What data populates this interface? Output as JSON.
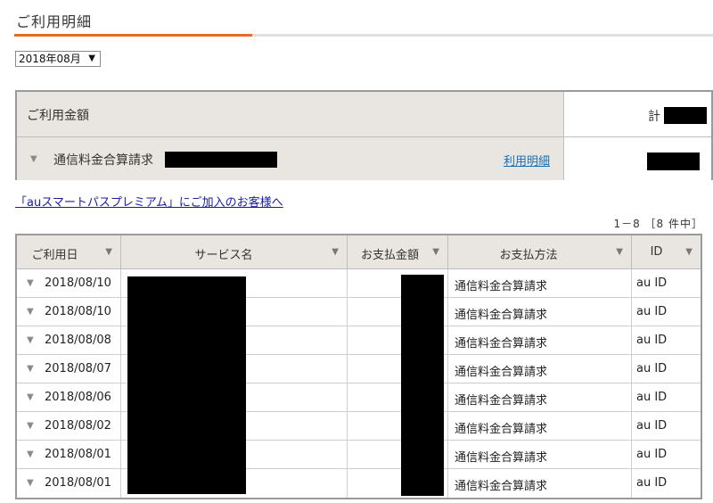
{
  "page": {
    "title": "ご利用明細"
  },
  "colors": {
    "accent": "#e8692e",
    "header_bg": "#e9e6e1",
    "link": "#1a6fb4",
    "redaction": "#000000"
  },
  "month_select": {
    "value": "2018年08月"
  },
  "summary": {
    "total_label": "ご利用金額",
    "total_prefix": "計",
    "service_label": "通信料金合算請求",
    "detail_link": "利用明細"
  },
  "promo_link": "「auスマートパスプレミアム」にご加入のお客様へ",
  "pagination": "1－8 ［8 件中］",
  "table": {
    "headers": [
      "ご利用日",
      "サービス名",
      "お支払金額",
      "お支払方法",
      "ID"
    ],
    "rows": [
      {
        "date": "2018/08/10",
        "method": "通信料金合算請求",
        "id": "au ID"
      },
      {
        "date": "2018/08/10",
        "method": "通信料金合算請求",
        "id": "au ID"
      },
      {
        "date": "2018/08/08",
        "method": "通信料金合算請求",
        "id": "au ID"
      },
      {
        "date": "2018/08/07",
        "method": "通信料金合算請求",
        "id": "au ID"
      },
      {
        "date": "2018/08/06",
        "method": "通信料金合算請求",
        "id": "au ID"
      },
      {
        "date": "2018/08/02",
        "method": "通信料金合算請求",
        "id": "au ID"
      },
      {
        "date": "2018/08/01",
        "method": "通信料金合算請求",
        "id": "au ID"
      },
      {
        "date": "2018/08/01",
        "method": "通信料金合算請求",
        "id": "au ID"
      }
    ]
  }
}
